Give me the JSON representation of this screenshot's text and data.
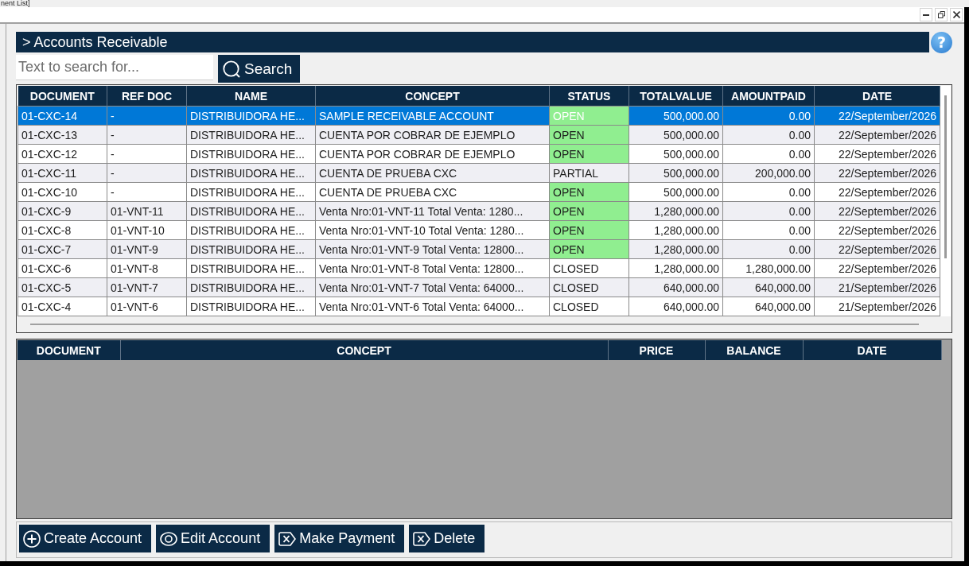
{
  "window": {
    "title": "nent List]"
  },
  "header": {
    "title": "> Accounts Receivable",
    "help": "?"
  },
  "search": {
    "placeholder": "Text to search for...",
    "button": "Search"
  },
  "accounts": {
    "columns": [
      "DOCUMENT",
      "REF DOC",
      "NAME",
      "CONCEPT",
      "STATUS",
      "TOTALVALUE",
      "AMOUNTPAID",
      "DATE"
    ],
    "rows": [
      {
        "document": "01-CXC-14",
        "ref_doc": "-",
        "name": "DISTRIBUIDORA HE...",
        "concept": "SAMPLE RECEIVABLE ACCOUNT",
        "status": {
          "text": "OPEN",
          "color": "#90ee90"
        },
        "total_value": "500,000.00",
        "amount_paid": "0.00",
        "date": "22/September/2026",
        "selected": true
      },
      {
        "document": "01-CXC-13",
        "ref_doc": "-",
        "name": "DISTRIBUIDORA HE...",
        "concept": "CUENTA POR COBRAR DE EJEMPLO",
        "status": {
          "text": "OPEN",
          "color": "#90ee90"
        },
        "total_value": "500,000.00",
        "amount_paid": "0.00",
        "date": "22/September/2026",
        "selected": false
      },
      {
        "document": "01-CXC-12",
        "ref_doc": "-",
        "name": "DISTRIBUIDORA HE...",
        "concept": "CUENTA POR COBRAR DE EJEMPLO",
        "status": {
          "text": "OPEN",
          "color": "#90ee90"
        },
        "total_value": "500,000.00",
        "amount_paid": "0.00",
        "date": "22/September/2026",
        "selected": false
      },
      {
        "document": "01-CXC-11",
        "ref_doc": "-",
        "name": "DISTRIBUIDORA HE...",
        "concept": "CUENTA DE PRUEBA CXC",
        "status": {
          "text": "PARTIAL"
        },
        "total_value": "500,000.00",
        "amount_paid": "200,000.00",
        "date": "22/September/2026",
        "selected": false
      },
      {
        "document": "01-CXC-10",
        "ref_doc": "-",
        "name": "DISTRIBUIDORA HE...",
        "concept": "CUENTA DE PRUEBA CXC",
        "status": {
          "text": "OPEN",
          "color": "#90ee90"
        },
        "total_value": "500,000.00",
        "amount_paid": "0.00",
        "date": "22/September/2026",
        "selected": false
      },
      {
        "document": "01-CXC-9",
        "ref_doc": "01-VNT-11",
        "name": "DISTRIBUIDORA HE...",
        "concept": "Venta Nro:01-VNT-11 Total Venta: 1280...",
        "status": {
          "text": "OPEN",
          "color": "#90ee90"
        },
        "total_value": "1,280,000.00",
        "amount_paid": "0.00",
        "date": "22/September/2026",
        "selected": false
      },
      {
        "document": "01-CXC-8",
        "ref_doc": "01-VNT-10",
        "name": "DISTRIBUIDORA HE...",
        "concept": "Venta Nro:01-VNT-10 Total Venta: 1280...",
        "status": {
          "text": "OPEN",
          "color": "#90ee90"
        },
        "total_value": "1,280,000.00",
        "amount_paid": "0.00",
        "date": "22/September/2026",
        "selected": false
      },
      {
        "document": "01-CXC-7",
        "ref_doc": "01-VNT-9",
        "name": "DISTRIBUIDORA HE...",
        "concept": "Venta Nro:01-VNT-9 Total Venta: 12800...",
        "status": {
          "text": "OPEN",
          "color": "#90ee90"
        },
        "total_value": "1,280,000.00",
        "amount_paid": "0.00",
        "date": "22/September/2026",
        "selected": false
      },
      {
        "document": "01-CXC-6",
        "ref_doc": "01-VNT-8",
        "name": "DISTRIBUIDORA HE...",
        "concept": "Venta Nro:01-VNT-8 Total Venta: 12800...",
        "status": {
          "text": "CLOSED"
        },
        "total_value": "1,280,000.00",
        "amount_paid": "1,280,000.00",
        "date": "22/September/2026",
        "selected": false
      },
      {
        "document": "01-CXC-5",
        "ref_doc": "01-VNT-7",
        "name": "DISTRIBUIDORA HE...",
        "concept": "Venta Nro:01-VNT-7 Total Venta: 64000...",
        "status": {
          "text": "CLOSED"
        },
        "total_value": "640,000.00",
        "amount_paid": "640,000.00",
        "date": "21/September/2026",
        "selected": false
      },
      {
        "document": "01-CXC-4",
        "ref_doc": "01-VNT-6",
        "name": "DISTRIBUIDORA HE...",
        "concept": "Venta Nro:01-VNT-6 Total Venta: 64000...",
        "status": {
          "text": "CLOSED"
        },
        "total_value": "640,000.00",
        "amount_paid": "640,000.00",
        "date": "21/September/2026",
        "selected": false
      }
    ]
  },
  "details": {
    "columns": [
      "DOCUMENT",
      "CONCEPT",
      "PRICE",
      "BALANCE",
      "DATE"
    ]
  },
  "actions": [
    {
      "label": "Create Account",
      "kind": "create"
    },
    {
      "label": "Edit Account",
      "kind": "edit"
    },
    {
      "label": "Make Payment",
      "kind": "payment"
    },
    {
      "label": "Delete",
      "kind": "delete"
    }
  ]
}
